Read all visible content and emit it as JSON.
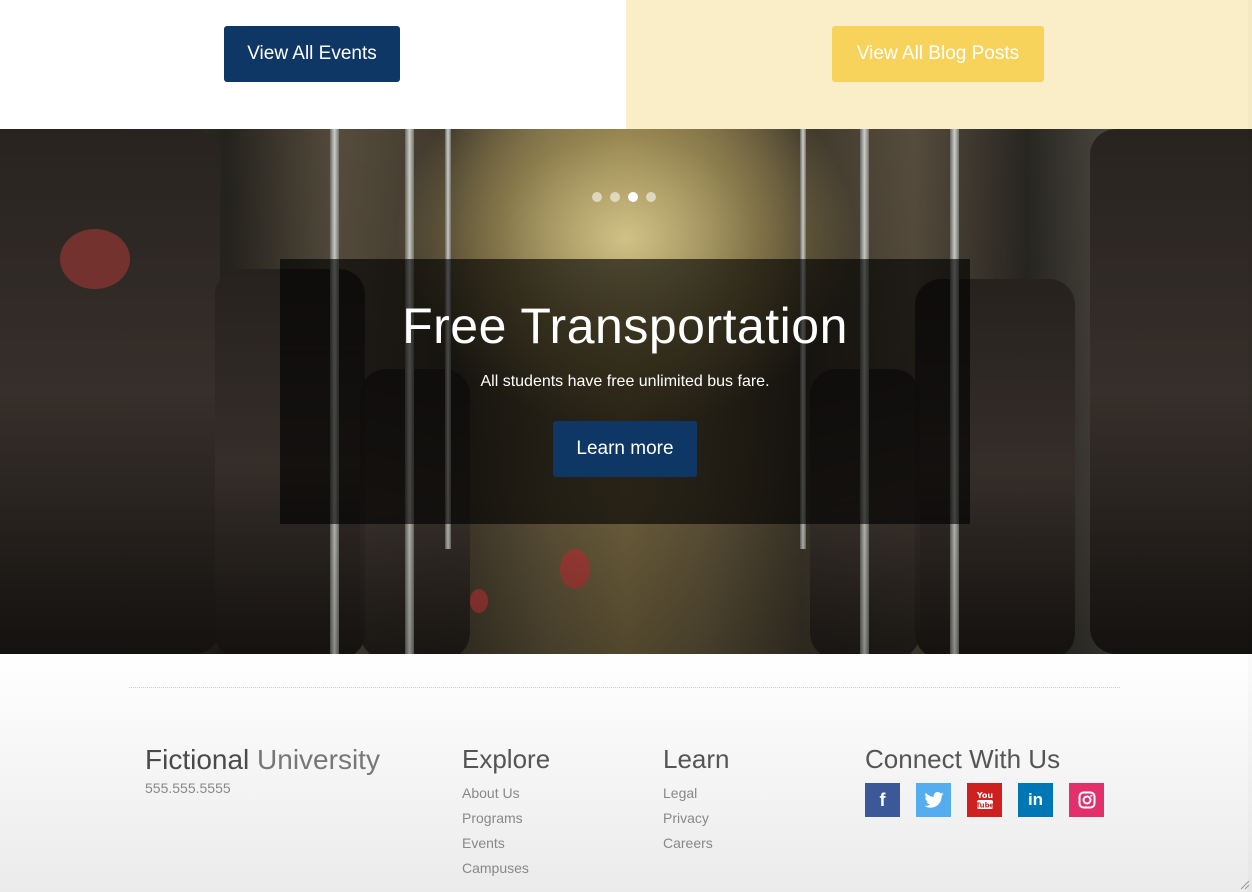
{
  "top": {
    "events_button": "View All Events",
    "blog_button": "View All Blog Posts"
  },
  "hero": {
    "title": "Free Transportation",
    "subtitle": "All students have free unlimited bus fare.",
    "cta": "Learn more",
    "slides": {
      "total": 4,
      "active": 3
    }
  },
  "footer": {
    "brand_bold": "Fictional",
    "brand_light": "University",
    "phone": "555.555.5555",
    "explore": {
      "title": "Explore",
      "links": [
        "About Us",
        "Programs",
        "Events",
        "Campuses"
      ]
    },
    "learn": {
      "title": "Learn",
      "links": [
        "Legal",
        "Privacy",
        "Careers"
      ]
    },
    "connect": {
      "title": "Connect With Us",
      "icons": [
        "facebook-icon",
        "twitter-icon",
        "youtube-icon",
        "linkedin-icon",
        "instagram-icon"
      ]
    }
  },
  "colors": {
    "primary_blue": "#0e3766",
    "gold": "#f7d35c",
    "cream": "#f9eec7"
  }
}
